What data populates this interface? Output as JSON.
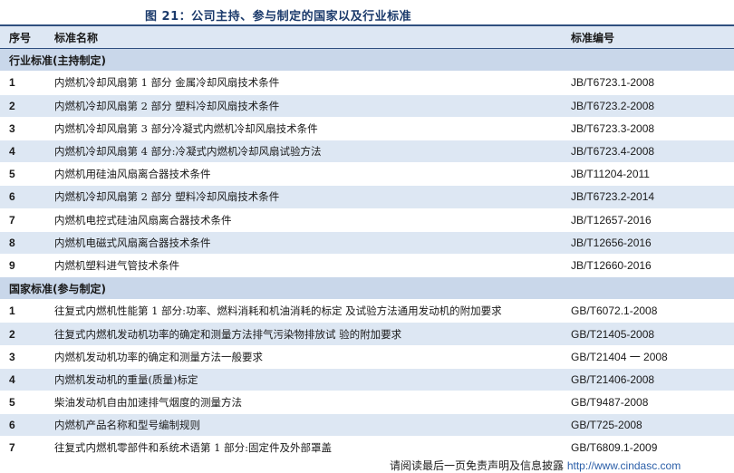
{
  "title": "图 21：公司主持、参与制定的国家以及行业标准",
  "headers": {
    "num": "序号",
    "name": "标准名称",
    "code": "标准编号"
  },
  "section1": {
    "label": "行业标准(主持制定)"
  },
  "industry_rows": [
    {
      "num": "1",
      "name": "内燃机冷却风扇第 1 部分 金属冷却风扇技术条件",
      "code": "JB/T6723.1-2008"
    },
    {
      "num": "2",
      "name": "内燃机冷却风扇第 2 部分 塑料冷却风扇技术条件",
      "code": "JB/T6723.2-2008"
    },
    {
      "num": "3",
      "name": "内燃机冷却风扇第 3 部分冷凝式内燃机冷却风扇技术条件",
      "code": "JB/T6723.3-2008"
    },
    {
      "num": "4",
      "name": "内燃机冷却风扇第 4 部分:冷凝式内燃机冷却风扇试验方法",
      "code": "JB/T6723.4-2008"
    },
    {
      "num": "5",
      "name": "内燃机用硅油风扇离合器技术条件",
      "code": "JB/T11204-2011"
    },
    {
      "num": "6",
      "name": "内燃机冷却风扇第 2 部分 塑料冷却风扇技术条件",
      "code": "JB/T6723.2-2014"
    },
    {
      "num": "7",
      "name": "内燃机电控式硅油风扇离合器技术条件",
      "code": "JB/T12657-2016"
    },
    {
      "num": "8",
      "name": "内燃机电磁式风扇离合器技术条件",
      "code": "JB/T12656-2016"
    },
    {
      "num": "9",
      "name": "内燃机塑料进气管技术条件",
      "code": "JB/T12660-2016"
    }
  ],
  "section2": {
    "label": "国家标准(参与制定)"
  },
  "national_rows": [
    {
      "num": "1",
      "name": "往复式内燃机性能第 1 部分:功率、燃料消耗和机油消耗的标定 及试验方法通用发动机的附加要求",
      "code": "GB/T6072.1-2008"
    },
    {
      "num": "2",
      "name": "往复式内燃机发动机功率的确定和测量方法排气污染物排放试 验的附加要求",
      "code": "GB/T21405-2008"
    },
    {
      "num": "3",
      "name": "内燃机发动机功率的确定和测量方法一般要求",
      "code": "GB/T21404 一 2008"
    },
    {
      "num": "4",
      "name": "内燃机发动机的重量(质量)标定",
      "code": "GB/T21406-2008"
    },
    {
      "num": "5",
      "name": "柴油发动机自由加速排气烟度的测量方法",
      "code": "GB/T9487-2008"
    },
    {
      "num": "6",
      "name": "内燃机产品名称和型号编制规则",
      "code": "GB/T725-2008"
    },
    {
      "num": "7",
      "name": "往复式内燃机零部件和系统术语第 1 部分:固定件及外部罩盖",
      "code": "GB/T6809.1-2009"
    }
  ],
  "footer": {
    "disclaimer": "请阅读最后一页免责声明及信息披露",
    "url": "http://www.cindasc.com"
  }
}
